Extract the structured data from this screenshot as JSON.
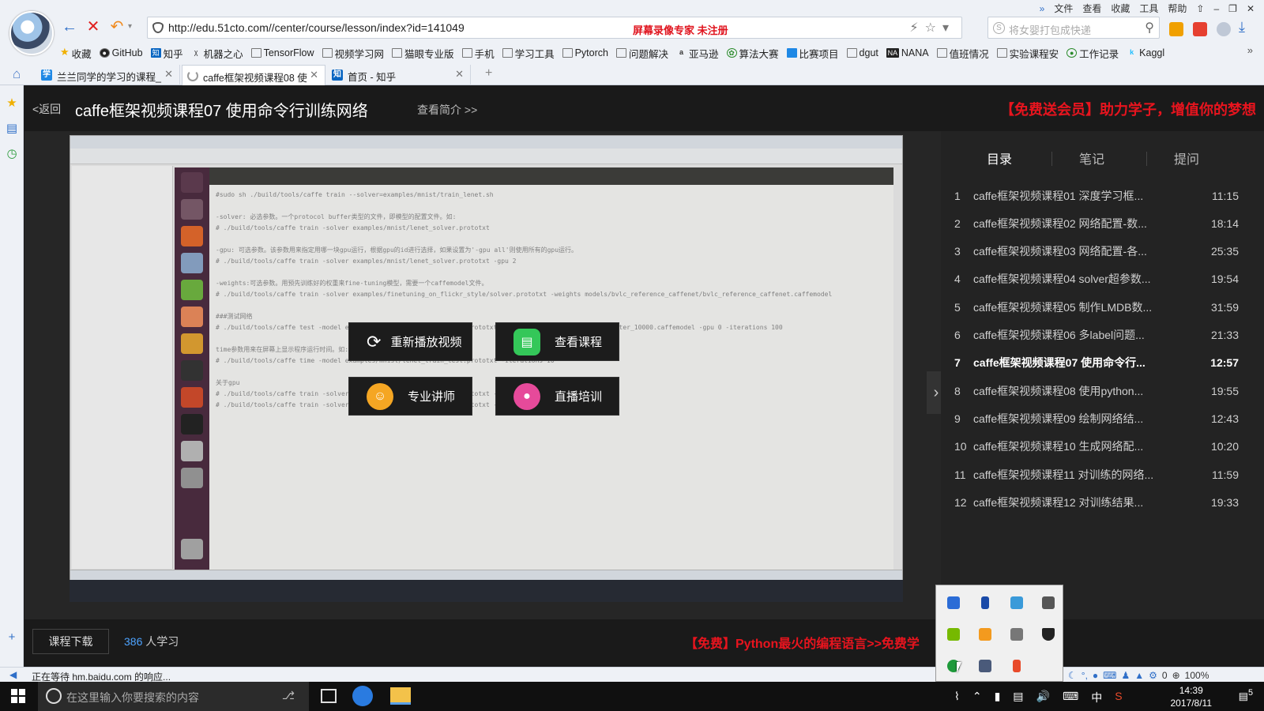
{
  "browser": {
    "url": "http://edu.51cto.com//center/course/lesson/index?id=141049",
    "watermark": "屏幕录像专家  未注册",
    "search_placeholder": "将女婴打包成快递",
    "menu": [
      "文件",
      "查看",
      "收藏",
      "工具",
      "帮助"
    ],
    "bookmarks": [
      "收藏",
      "GitHub",
      "知乎",
      "机器之心",
      "TensorFlow",
      "视频学习网",
      "猫眼专业版",
      "手机",
      "学习工具",
      "Pytorch",
      "问题解决",
      "亚马逊",
      "算法大赛",
      "比赛项目",
      "dgut",
      "NANA",
      "值班情况",
      "实验课程安",
      "工作记录",
      "Kaggl"
    ],
    "tabs": [
      {
        "label": "兰兰同学的学习的课程_",
        "active": false
      },
      {
        "label": "caffe框架视频课程08 使",
        "active": true
      },
      {
        "label": "首页 - 知乎",
        "active": false
      }
    ],
    "status_text": "正在等待 hm.baidu.com 的响应...",
    "zoom": "100%",
    "status_count": "0"
  },
  "header": {
    "back_label": "<返回",
    "title": "caffe框架视频课程07 使用命令行训练网络",
    "intro_link": "查看简介 >>",
    "promo": "【免费送会员】助力学子，增值你的梦想"
  },
  "overlay": {
    "replay": "重新播放视频",
    "view_course": "查看课程",
    "teacher": "专业讲师",
    "live": "直播培训"
  },
  "panel": {
    "tabs": [
      "目录",
      "笔记",
      "提问"
    ],
    "lessons": [
      {
        "n": "1",
        "title": "caffe框架视频课程01 深度学习框...",
        "dur": "11:15"
      },
      {
        "n": "2",
        "title": "caffe框架视频课程02 网络配置-数...",
        "dur": "18:14"
      },
      {
        "n": "3",
        "title": "caffe框架视频课程03 网络配置-各...",
        "dur": "25:35"
      },
      {
        "n": "4",
        "title": "caffe框架视频课程04 solver超参数...",
        "dur": "19:54"
      },
      {
        "n": "5",
        "title": "caffe框架视频课程05 制作LMDB数...",
        "dur": "31:59"
      },
      {
        "n": "6",
        "title": "caffe框架视频课程06 多label问题...",
        "dur": "21:33"
      },
      {
        "n": "7",
        "title": "caffe框架视频课程07 使用命令行...",
        "dur": "12:57"
      },
      {
        "n": "8",
        "title": "caffe框架视频课程08 使用python...",
        "dur": "19:55"
      },
      {
        "n": "9",
        "title": "caffe框架视频课程09 绘制网络结...",
        "dur": "12:43"
      },
      {
        "n": "10",
        "title": "caffe框架视频课程10 生成网络配...",
        "dur": "10:20"
      },
      {
        "n": "11",
        "title": "caffe框架视频课程11 对训练的网络...",
        "dur": "11:59"
      },
      {
        "n": "12",
        "title": "caffe框架视频课程12 对训练结果...",
        "dur": "19:33"
      }
    ],
    "active_index": 6
  },
  "footer": {
    "download": "课程下载",
    "learners_count": "386",
    "learners_label": "人学习",
    "promo": "【免费】Python最火的编程语言>>免费学"
  },
  "taskbar": {
    "search_placeholder": "在这里输入你要搜索的内容",
    "ime": "中",
    "time": "14:39",
    "date": "2017/8/11",
    "notifications": "5"
  },
  "video_code": "#sudo sh ./build/tools/caffe train --solver=examples/mnist/train_lenet.sh\n\n-solver: 必选参数。一个protocol buffer类型的文件，即模型的配置文件。如:\n# ./build/tools/caffe train -solver examples/mnist/lenet_solver.prototxt\n\n-gpu: 可选参数。该参数用来指定用哪一块gpu运行，根据gpu的id进行选择，如果设置为'-gpu all'则使用所有的gpu运行。\n# ./build/tools/caffe train -solver examples/mnist/lenet_solver.prototxt -gpu 2\n\n-weights:可选参数。用预先训练好的权重来fine-tuning模型，需要一个caffemodel文件。\n# ./build/tools/caffe train -solver examples/finetuning_on_flickr_style/solver.prototxt -weights models/bvlc_reference_caffenet/bvlc_reference_caffenet.caffemodel\n\n###测试网络\n# ./build/tools/caffe test -model examples/mnist/lenet_train_test.prototxt -weights examples/mnist/lenet_iter_10000.caffemodel -gpu 0 -iterations 100\n\ntime参数用来在屏幕上显示程序运行时间。如:\n# ./build/tools/caffe time -model examples/mnist/lenet_train_test.prototxt -iterations 10\n\n关于gpu\n# ./build/tools/caffe train -solver examples/mnist/lenet_solver.prototxt -gpu 0,1\n# ./build/tools/caffe train -solver examples/mnist/lenet_solver.prototxt -gpu all"
}
